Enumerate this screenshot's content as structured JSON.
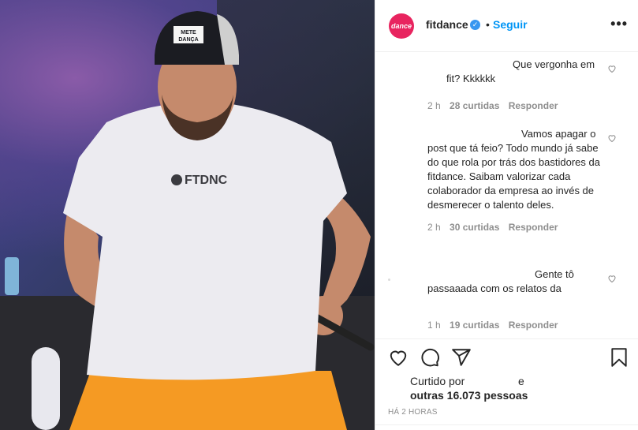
{
  "post": {
    "username": "fitdance",
    "avatar_text": "dance",
    "avatar_color": "#e8245f",
    "verified_icon": "verified-badge-icon",
    "separator": "•",
    "follow_label": "Seguir",
    "more_label": "•••"
  },
  "comments": [
    {
      "text": "Que vergonha em fit? Kkkkkk",
      "time": "2 h",
      "likes": "28 curtidas",
      "reply": "Responder"
    },
    {
      "text": "Vamos apagar o post que tá feio? Todo mundo já sabe do que rola por trás dos bastidores da fitdance. Saibam valorizar cada colaborador da empresa ao invés de desmerecer o talento deles.",
      "time": "2 h",
      "likes": "30 curtidas",
      "reply": "Responder"
    },
    {
      "text": "Gente tô passaaada com os relatos da",
      "time": "1 h",
      "likes": "19 curtidas",
      "reply": "Responder"
    }
  ],
  "likes": {
    "prefix": "Curtido por",
    "and": "e",
    "others": "outras 16.073 pessoas"
  },
  "timestamp": "HÁ 2 HORAS",
  "photo": {
    "cap_text_line1": "METE",
    "cap_text_line2": "DANÇA",
    "shirt_logo": "FTDNC",
    "colors": {
      "shirt": "#ecebf0",
      "shorts": "#f59a23",
      "cap": "#1b1c22",
      "skin": "#c58a6c"
    }
  }
}
